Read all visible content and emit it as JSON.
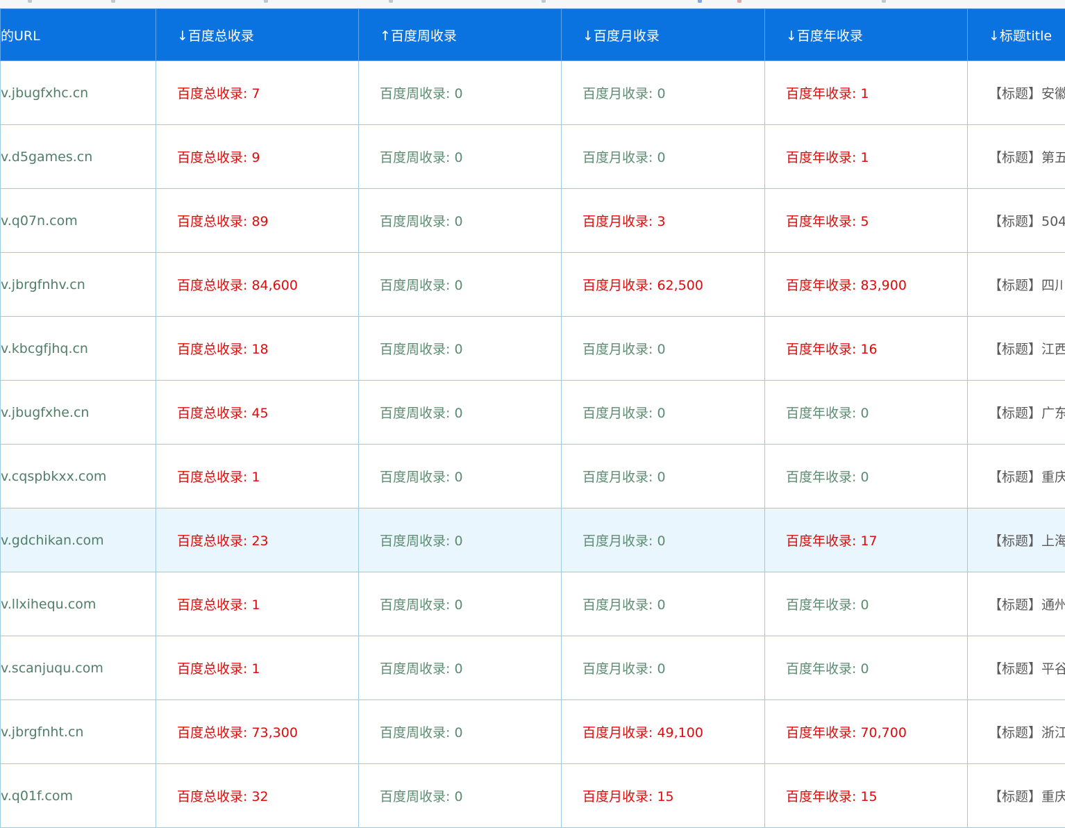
{
  "table": {
    "headers": [
      "的URL",
      "↓百度总收录",
      "↑百度周收录",
      "↓百度月收录",
      "↓百度年收录",
      "↓标题title"
    ],
    "colors": {
      "indexed": "#e00a0a",
      "zero": "#5c8c70",
      "header_bg": "#0a73e0",
      "highlight_row_bg": "#eaf6fd"
    },
    "rows": [
      {
        "url": "v.jbugfxhc.cn",
        "total": "百度总收录: 7",
        "total_hit": true,
        "week": "百度周收录: 0",
        "week_hit": false,
        "month": "百度月收录: 0",
        "month_hit": false,
        "year": "百度年收录: 1",
        "year_hit": true,
        "title": "【标题】安徽",
        "highlight": false
      },
      {
        "url": "v.d5games.cn",
        "total": "百度总收录: 9",
        "total_hit": true,
        "week": "百度周收录: 0",
        "week_hit": false,
        "month": "百度月收录: 0",
        "month_hit": false,
        "year": "百度年收录: 1",
        "year_hit": true,
        "title": "【标题】第五",
        "highlight": false
      },
      {
        "url": "v.q07n.com",
        "total": "百度总收录: 89",
        "total_hit": true,
        "week": "百度周收录: 0",
        "week_hit": false,
        "month": "百度月收录: 3",
        "month_hit": true,
        "year": "百度年收录: 5",
        "year_hit": true,
        "title": "【标题】504",
        "highlight": false
      },
      {
        "url": "v.jbrgfnhv.cn",
        "total": "百度总收录: 84,600",
        "total_hit": true,
        "week": "百度周收录: 0",
        "week_hit": false,
        "month": "百度月收录: 62,500",
        "month_hit": true,
        "year": "百度年收录: 83,900",
        "year_hit": true,
        "title": "【标题】四川",
        "highlight": false
      },
      {
        "url": "v.kbcgfjhq.cn",
        "total": "百度总收录: 18",
        "total_hit": true,
        "week": "百度周收录: 0",
        "week_hit": false,
        "month": "百度月收录: 0",
        "month_hit": false,
        "year": "百度年收录: 16",
        "year_hit": true,
        "title": "【标题】江西",
        "highlight": false
      },
      {
        "url": "v.jbugfxhe.cn",
        "total": "百度总收录: 45",
        "total_hit": true,
        "week": "百度周收录: 0",
        "week_hit": false,
        "month": "百度月收录: 0",
        "month_hit": false,
        "year": "百度年收录: 0",
        "year_hit": false,
        "title": "【标题】广东",
        "highlight": false
      },
      {
        "url": "v.cqspbkxx.com",
        "total": "百度总收录: 1",
        "total_hit": true,
        "week": "百度周收录: 0",
        "week_hit": false,
        "month": "百度月收录: 0",
        "month_hit": false,
        "year": "百度年收录: 0",
        "year_hit": false,
        "title": "【标题】重庆",
        "highlight": false
      },
      {
        "url": "v.gdchikan.com",
        "total": "百度总收录: 23",
        "total_hit": true,
        "week": "百度周收录: 0",
        "week_hit": false,
        "month": "百度月收录: 0",
        "month_hit": false,
        "year": "百度年收录: 17",
        "year_hit": true,
        "title": "【标题】上海",
        "highlight": true
      },
      {
        "url": "v.llxihequ.com",
        "total": "百度总收录: 1",
        "total_hit": true,
        "week": "百度周收录: 0",
        "week_hit": false,
        "month": "百度月收录: 0",
        "month_hit": false,
        "year": "百度年收录: 0",
        "year_hit": false,
        "title": "【标题】通州",
        "highlight": false
      },
      {
        "url": "v.scanjuqu.com",
        "total": "百度总收录: 1",
        "total_hit": true,
        "week": "百度周收录: 0",
        "week_hit": false,
        "month": "百度月收录: 0",
        "month_hit": false,
        "year": "百度年收录: 0",
        "year_hit": false,
        "title": "【标题】平谷",
        "highlight": false
      },
      {
        "url": "v.jbrgfnht.cn",
        "total": "百度总收录: 73,300",
        "total_hit": true,
        "week": "百度周收录: 0",
        "week_hit": false,
        "month": "百度月收录: 49,100",
        "month_hit": true,
        "year": "百度年收录: 70,700",
        "year_hit": true,
        "title": "【标题】浙江",
        "highlight": false
      },
      {
        "url": "v.q01f.com",
        "total": "百度总收录: 32",
        "total_hit": true,
        "week": "百度周收录: 0",
        "week_hit": false,
        "month": "百度月收录: 15",
        "month_hit": true,
        "year": "百度年收录: 15",
        "year_hit": true,
        "title": "【标题】重庆",
        "highlight": false
      }
    ]
  }
}
